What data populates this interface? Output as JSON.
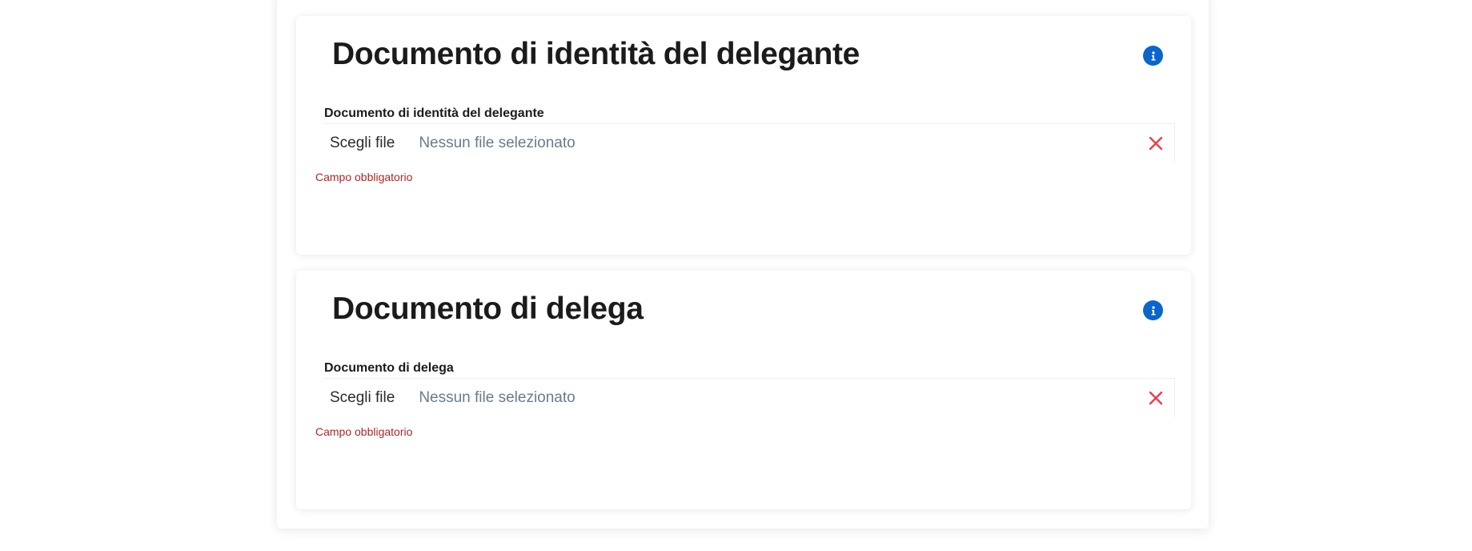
{
  "sections": [
    {
      "title": "Documento di identità del delegante",
      "field_label": "Documento di identità del delegante",
      "choose_file_label": "Scegli file",
      "file_status": "Nessun file selezionato",
      "error": "Campo obbligatorio"
    },
    {
      "title": "Documento di delega",
      "field_label": "Documento di delega",
      "choose_file_label": "Scegli file",
      "file_status": "Nessun file selezionato",
      "error": "Campo obbligatorio"
    }
  ],
  "icons": {
    "info": "info-icon",
    "clear": "close-icon"
  },
  "colors": {
    "info_icon": "#0b66c8",
    "clear_icon": "#e8404f",
    "error_text": "#a32a2a",
    "placeholder_text": "#6b7a8c"
  }
}
